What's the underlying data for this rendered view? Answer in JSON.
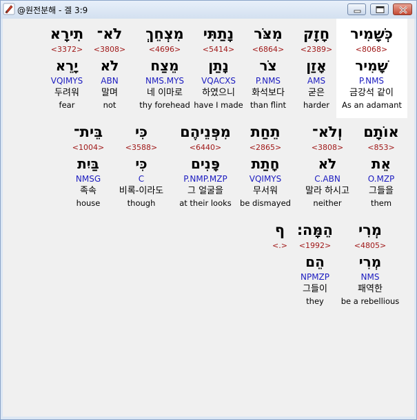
{
  "window": {
    "title": "@원전분해 - 겔 3:9"
  },
  "rows": [
    {
      "words": [
        {
          "heb": "כְּשָׁמִיר",
          "strong": "<8068>",
          "lemma": "שָׁמִיר",
          "morph": "P.NMS",
          "kor": "금강석 같이",
          "eng": "As an adamant",
          "highlight": true
        },
        {
          "heb": "חָזָק",
          "strong": "<2389>",
          "lemma": "אָזַן",
          "morph": "AMS",
          "kor": "굳은",
          "eng": "harder"
        },
        {
          "heb": "מִצֹּר",
          "strong": "<6864>",
          "lemma": "צֹר",
          "morph": "P.NMS",
          "kor": "화석보다",
          "eng": "than flint"
        },
        {
          "heb": "נָתַתִּי",
          "strong": "<5414>",
          "lemma": "נָתַן",
          "morph": "VQACXS",
          "kor": "하였으니",
          "eng": "have I made"
        },
        {
          "heb": "מִצְחֵךְ",
          "strong": "<4696>",
          "lemma": "מֵצַח",
          "morph": "NMS.MYS",
          "kor": "네 이마로",
          "eng": "thy forehead"
        },
        {
          "heb": "לֹא־",
          "strong": "<3808>",
          "lemma": "לֹא",
          "morph": "ABN",
          "kor": "말며",
          "eng": "not"
        },
        {
          "heb": "תִירָא",
          "strong": "<3372>",
          "lemma": "יָרֵא",
          "morph": "VQIMYS",
          "kor": "두려워",
          "eng": "fear"
        }
      ]
    },
    {
      "words": [
        {
          "heb": "אוֹתָם",
          "strong": "<853>",
          "lemma": "אֵת",
          "morph": "O.MZP",
          "kor": "그들을",
          "eng": "them"
        },
        {
          "heb": "וְלֹא־",
          "strong": "<3808>",
          "lemma": "לֹא",
          "morph": "C.ABN",
          "kor": "말라 하시고",
          "eng": "neither"
        },
        {
          "heb": "תֵחַת",
          "strong": "<2865>",
          "lemma": "חָתַת",
          "morph": "VQIMYS",
          "kor": "무서워",
          "eng": "be dismayed"
        },
        {
          "heb": "מִפְּנֵיהֶם",
          "strong": "<6440>",
          "lemma": "פָּנִים",
          "morph": "P.NMP.MZP",
          "kor": "그 얼굴을",
          "eng": "at their looks"
        },
        {
          "heb": "כִּי",
          "strong": "<3588>",
          "lemma": "כִּי",
          "morph": "C",
          "kor": "비록-이라도",
          "eng": "though"
        },
        {
          "heb": "בֵּית־",
          "strong": "<1004>",
          "lemma": "בַּיִת",
          "morph": "NMSG",
          "kor": "족속",
          "eng": "house"
        }
      ]
    },
    {
      "words": [
        {
          "heb": "מְרִי",
          "strong": "<4805>",
          "lemma": "מְרִי",
          "morph": "NMS",
          "kor": "패역한",
          "eng": "be a rebellious"
        },
        {
          "heb": "הֵמָּה׃",
          "strong": "<1992>",
          "lemma": "הֵם",
          "morph": "NPMZP",
          "kor": "그들이",
          "eng": "they"
        },
        {
          "heb": "ף",
          "strong": "<.>",
          "lemma": "",
          "morph": "",
          "kor": "",
          "eng": ""
        }
      ]
    }
  ],
  "icons": {
    "app": "pen-icon",
    "minimize": "minimize-icon",
    "maximize": "maximize-icon",
    "close": "close-icon"
  }
}
